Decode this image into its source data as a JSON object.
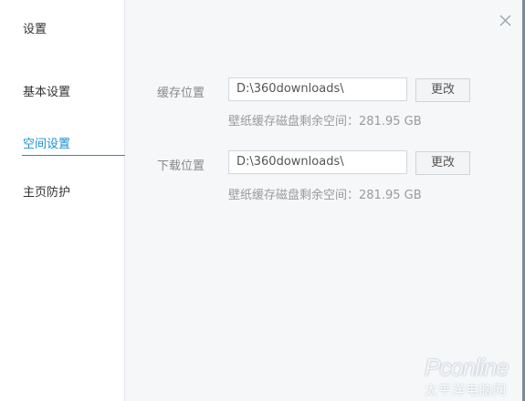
{
  "sidebar": {
    "title": "设置",
    "items": [
      {
        "label": "基本设置",
        "active": false
      },
      {
        "label": "空间设置",
        "active": true
      },
      {
        "label": "主页防护",
        "active": false
      }
    ]
  },
  "main": {
    "cache": {
      "label": "缓存位置",
      "path": "D:\\360downloads\\",
      "change_label": "更改",
      "space_info": "壁纸缓存磁盘剩余空间：281.95 GB"
    },
    "download": {
      "label": "下载位置",
      "path": "D:\\360downloads\\",
      "change_label": "更改",
      "space_info": "壁纸缓存磁盘剩余空间：281.95 GB"
    }
  },
  "watermark": {
    "brand": "Pconline",
    "sub": "太平洋电脑网"
  },
  "colors": {
    "accent": "#1a8fd6",
    "background": "#f5f7f9",
    "sidebar": "#ffffff"
  },
  "icons": {
    "close": "close-icon"
  }
}
